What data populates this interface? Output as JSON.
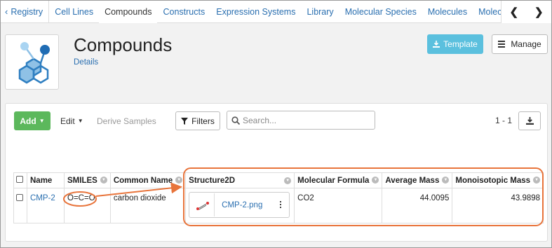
{
  "nav": {
    "back_label": "Registry",
    "tabs": [
      {
        "label": "Cell Lines"
      },
      {
        "label": "Compounds"
      },
      {
        "label": "Constructs"
      },
      {
        "label": "Expression Systems"
      },
      {
        "label": "Library"
      },
      {
        "label": "Molecular Species"
      },
      {
        "label": "Molecules"
      },
      {
        "label": "Molecule Sets"
      }
    ],
    "active_tab": "Compounds",
    "icons": {
      "back": "chevron-left-icon",
      "prev": "chevron-left-icon",
      "next": "chevron-right-icon"
    }
  },
  "header": {
    "title": "Compounds",
    "details_link": "Details",
    "template_button": "Template",
    "manage_button": "Manage",
    "logo_icon": "molecule-icon"
  },
  "toolbar": {
    "add_label": "Add",
    "edit_label": "Edit",
    "derive_label": "Derive Samples",
    "filters_label": "Filters",
    "search_placeholder": "Search...",
    "pager_count": "1 - 1"
  },
  "table": {
    "columns": [
      "Name",
      "SMILES",
      "Common Name",
      "Structure2D",
      "Molecular Formula",
      "Average Mass",
      "Monoisotopic Mass"
    ],
    "rows": [
      {
        "name": "CMP-2",
        "smiles": "O=C=O",
        "common_name": "carbon dioxide",
        "structure_file": "CMP-2.png",
        "molecular_formula": "CO2",
        "average_mass": "44.0095",
        "monoisotopic_mass": "43.9898"
      }
    ]
  },
  "colors": {
    "link": "#2a6fb0",
    "add_button": "#5cb85c",
    "template_button": "#5bc0de",
    "annotation": "#e8743b"
  }
}
